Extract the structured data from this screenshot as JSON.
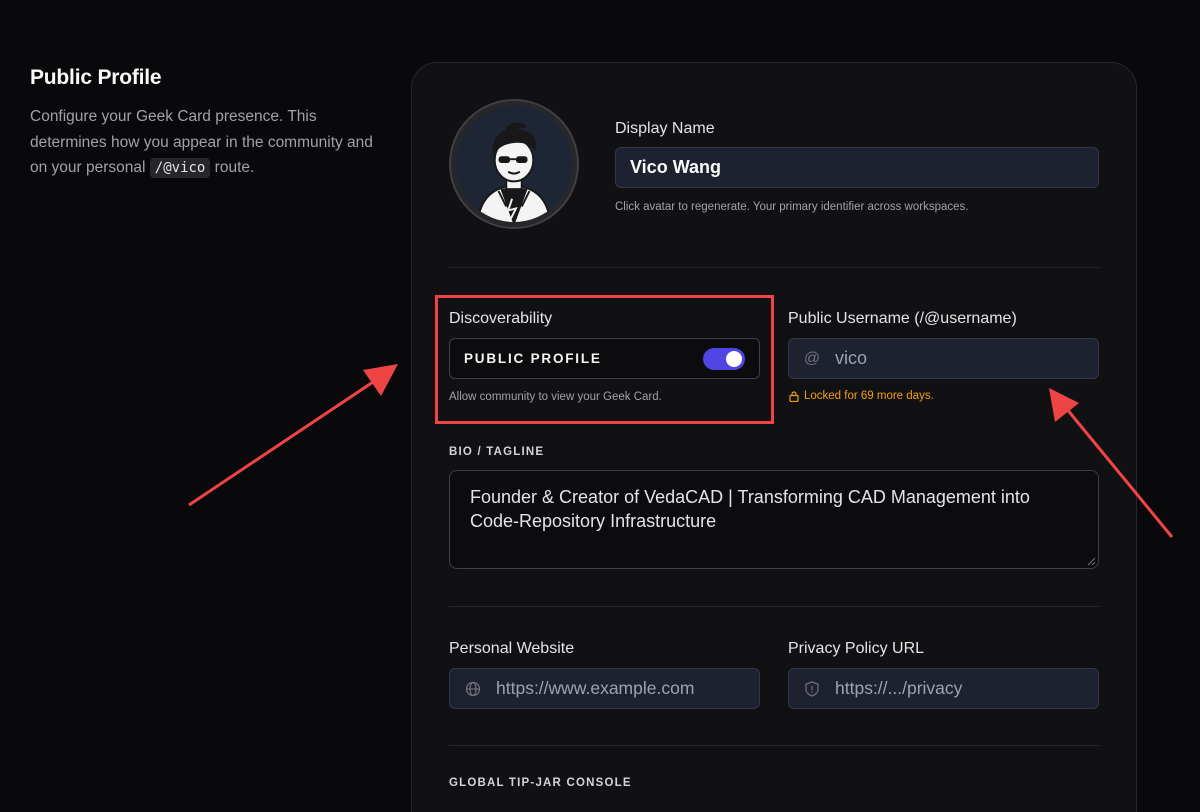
{
  "intro": {
    "title": "Public Profile",
    "description_before": "Configure your Geek Card presence. This determines how you appear in the community and on your personal ",
    "route": "/@vico",
    "description_after": " route."
  },
  "profile": {
    "display_name_label": "Display Name",
    "display_name_value": "Vico Wang",
    "display_name_hint": "Click avatar to regenerate. Your primary identifier across workspaces.",
    "avatar_icon": "avatar-icon"
  },
  "discoverability": {
    "label": "Discoverability",
    "toggle_label": "PUBLIC PROFILE",
    "toggle_on": true,
    "hint": "Allow community to view your Geek Card."
  },
  "username": {
    "label": "Public Username (/@username)",
    "prefix": "@",
    "value": "vico",
    "lock_note": "Locked for 69 more days."
  },
  "bio": {
    "label": "BIO / TAGLINE",
    "value": "Founder & Creator of VedaCAD | Transforming CAD Management into Code-Repository Infrastructure"
  },
  "website": {
    "label": "Personal Website",
    "placeholder": "https://www.example.com",
    "icon": "globe-icon"
  },
  "privacy": {
    "label": "Privacy Policy URL",
    "placeholder": "https://.../privacy",
    "icon": "shield-icon"
  },
  "tipjar": {
    "label": "GLOBAL TIP-JAR CONSOLE"
  },
  "colors": {
    "accent": "#4f46e5",
    "highlight": "#ef4444",
    "warning": "#f59e0b"
  }
}
